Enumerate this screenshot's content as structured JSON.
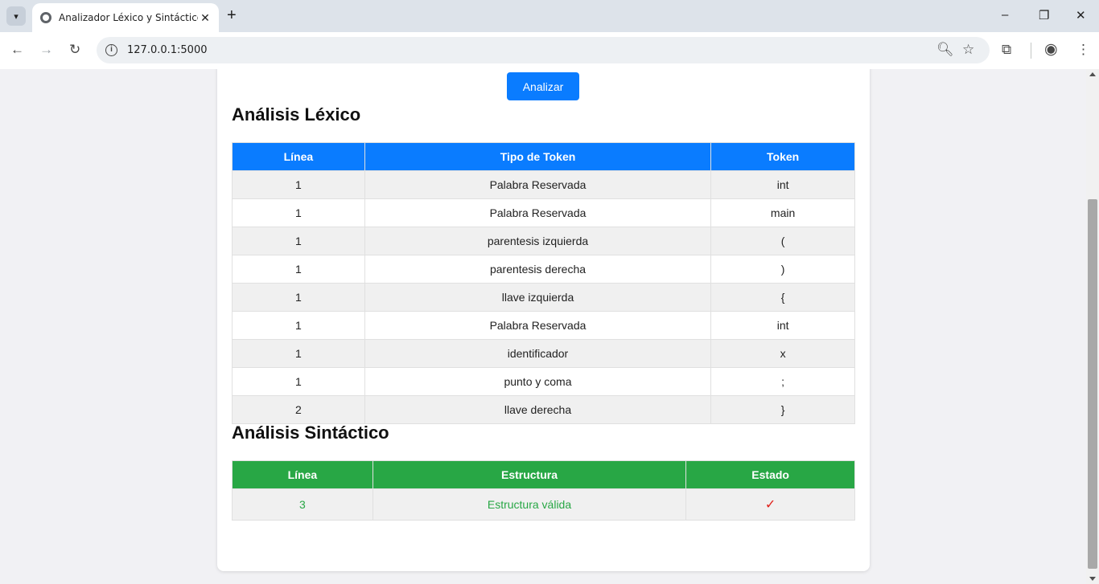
{
  "browser": {
    "tab_title": "Analizador Léxico y Sintáctico",
    "tab_close": "✕",
    "new_tab": "+",
    "url": "127.0.0.1:5000",
    "window": {
      "minimize": "–",
      "restore": "❐",
      "close": "✕"
    }
  },
  "page": {
    "analyze_button": "Analizar",
    "lexical": {
      "heading": "Análisis Léxico",
      "columns": [
        "Línea",
        "Tipo de Token",
        "Token"
      ],
      "rows": [
        [
          "1",
          "Palabra Reservada",
          "int"
        ],
        [
          "1",
          "Palabra Reservada",
          "main"
        ],
        [
          "1",
          "parentesis izquierda",
          "("
        ],
        [
          "1",
          "parentesis derecha",
          ")"
        ],
        [
          "1",
          "llave izquierda",
          "{"
        ],
        [
          "1",
          "Palabra Reservada",
          "int"
        ],
        [
          "1",
          "identificador",
          "x"
        ],
        [
          "1",
          "punto y coma",
          ";"
        ],
        [
          "2",
          "llave derecha",
          "}"
        ]
      ]
    },
    "syntactic": {
      "heading": "Análisis Sintáctico",
      "columns": [
        "Línea",
        "Estructura",
        "Estado"
      ],
      "rows": [
        [
          "3",
          "Estructura válida",
          "✓"
        ]
      ]
    }
  },
  "colors": {
    "lexical_header": "#0a7cff",
    "syntactic_header": "#28a745",
    "status_check": "#e0201a"
  }
}
